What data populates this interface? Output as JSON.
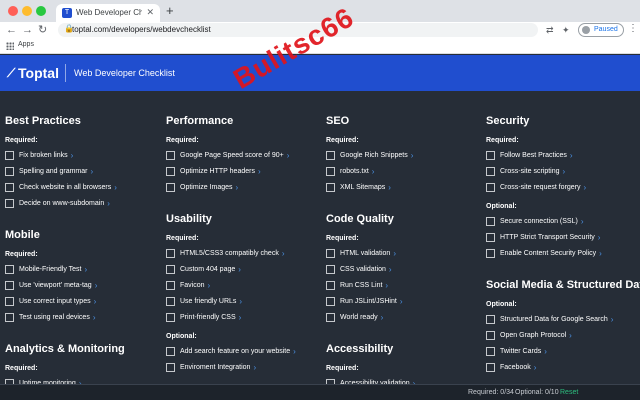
{
  "browser": {
    "tab_title": "Web Developer Checklist: Web",
    "tab_favicon": "T",
    "url": "toptal.com/developers/webdevchecklist",
    "profile_label": "Paused",
    "bookmark_apps": "Apps"
  },
  "header": {
    "logo": "Toptal",
    "title": "Web Developer Checklist"
  },
  "columns": [
    {
      "sections": [
        {
          "title": "Best Practices",
          "groups": [
            {
              "label": "Required:",
              "items": [
                "Fix broken links",
                "Spelling and grammar",
                "Check website in all browsers",
                "Decide on www-subdomain"
              ]
            }
          ]
        },
        {
          "title": "Mobile",
          "groups": [
            {
              "label": "Required:",
              "items": [
                "Mobile-Friendly Test",
                "Use 'viewport' meta-tag",
                "Use correct input types",
                "Test using real devices"
              ]
            }
          ]
        },
        {
          "title": "Analytics & Monitoring",
          "groups": [
            {
              "label": "Required:",
              "items": [
                "Uptime monitoring",
                ""
              ]
            }
          ]
        }
      ]
    },
    {
      "sections": [
        {
          "title": "Performance",
          "groups": [
            {
              "label": "Required:",
              "items": [
                "Google Page Speed score of 90+",
                "Optimize HTTP headers",
                "Optimize Images"
              ]
            }
          ]
        },
        {
          "title": "Usability",
          "groups": [
            {
              "label": "Required:",
              "items": [
                "HTML5/CSS3 compatibly check",
                "Custom 404 page",
                "Favicon",
                "Use friendly URLs",
                "Print-friendly CSS"
              ]
            },
            {
              "label": "Optional:",
              "items": [
                "Add search feature on your website",
                "Enviroment Integration"
              ]
            }
          ]
        }
      ]
    },
    {
      "sections": [
        {
          "title": "SEO",
          "groups": [
            {
              "label": "Required:",
              "items": [
                "Google Rich Snippets",
                "robots.txt",
                "XML Sitemaps"
              ]
            }
          ]
        },
        {
          "title": "Code Quality",
          "groups": [
            {
              "label": "Required:",
              "items": [
                "HTML validation",
                "CSS validation",
                "Run CSS Lint",
                "Run JSLint/JSHint",
                "World ready"
              ]
            }
          ]
        },
        {
          "title": "Accessibility",
          "groups": [
            {
              "label": "Required:",
              "items": [
                "Accessibility validation",
                ""
              ]
            }
          ]
        }
      ]
    },
    {
      "sections": [
        {
          "title": "Security",
          "groups": [
            {
              "label": "Required:",
              "items": [
                "Follow Best Practices",
                "Cross-site scripting",
                "Cross-site request forgery"
              ]
            },
            {
              "label": "Optional:",
              "items": [
                "Secure connection (SSL)",
                "HTTP Strict Transport Security",
                "Enable Content Security Policy"
              ]
            }
          ]
        },
        {
          "title": "Social Media & Structured Data",
          "groups": [
            {
              "label": "Optional:",
              "items": [
                "Structured Data for Google Search",
                "Open Graph Protocol",
                "Twitter Cards",
                "Facebook"
              ]
            }
          ]
        }
      ]
    }
  ],
  "footer": {
    "required": "Required: 0/34",
    "optional": "Optional: 0/10",
    "reset": "Reset"
  },
  "watermark": "Bulitsc66",
  "colors": {
    "brand": "#204ecf",
    "background": "#262d37",
    "reset": "#2dbd7e",
    "watermark": "#e0141b"
  }
}
